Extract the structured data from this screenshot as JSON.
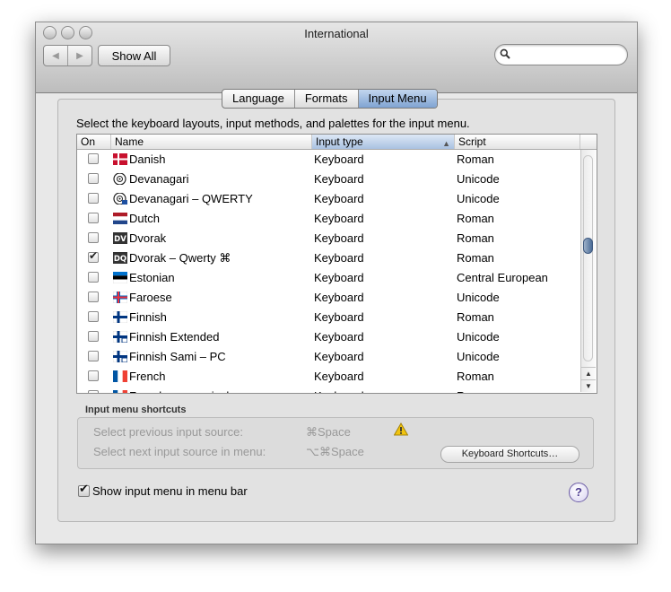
{
  "window": {
    "title": "International"
  },
  "toolbar": {
    "back_icon": "◀",
    "forward_icon": "▶",
    "show_all": "Show All",
    "search_placeholder": ""
  },
  "tabs": [
    {
      "label": "Language",
      "active": false
    },
    {
      "label": "Formats",
      "active": false
    },
    {
      "label": "Input Menu",
      "active": true
    }
  ],
  "instruction": "Select the keyboard layouts, input methods, and palettes for the input menu.",
  "table": {
    "columns": {
      "on": "On",
      "name": "Name",
      "input_type": "Input type",
      "script": "Script",
      "sort_arrow": "▲"
    },
    "rows": [
      {
        "checked": false,
        "flag": "danish-flag-icon",
        "name": "Danish",
        "type": "Keyboard",
        "script": "Roman"
      },
      {
        "checked": false,
        "flag": "devanagari-icon",
        "name": "Devanagari",
        "type": "Keyboard",
        "script": "Unicode"
      },
      {
        "checked": false,
        "flag": "devanagari-qwerty-icon",
        "name": "Devanagari – QWERTY",
        "type": "Keyboard",
        "script": "Unicode"
      },
      {
        "checked": false,
        "flag": "dutch-flag-icon",
        "name": "Dutch",
        "type": "Keyboard",
        "script": "Roman"
      },
      {
        "checked": false,
        "flag": "dvorak-icon",
        "badge": "DV",
        "name": "Dvorak",
        "type": "Keyboard",
        "script": "Roman"
      },
      {
        "checked": true,
        "flag": "dvorak-qwerty-icon",
        "badge": "DQ",
        "name": "Dvorak – Qwerty ⌘",
        "type": "Keyboard",
        "script": "Roman"
      },
      {
        "checked": false,
        "flag": "estonian-flag-icon",
        "name": "Estonian",
        "type": "Keyboard",
        "script": "Central European"
      },
      {
        "checked": false,
        "flag": "faroese-flag-icon",
        "name": "Faroese",
        "type": "Keyboard",
        "script": "Unicode"
      },
      {
        "checked": false,
        "flag": "finnish-flag-icon",
        "name": "Finnish",
        "type": "Keyboard",
        "script": "Roman"
      },
      {
        "checked": false,
        "flag": "finnish-extended-icon",
        "name": "Finnish Extended",
        "type": "Keyboard",
        "script": "Unicode"
      },
      {
        "checked": false,
        "flag": "finnish-sami-icon",
        "name": "Finnish Sami – PC",
        "type": "Keyboard",
        "script": "Unicode"
      },
      {
        "checked": false,
        "flag": "french-flag-icon",
        "name": "French",
        "type": "Keyboard",
        "script": "Roman"
      },
      {
        "checked": false,
        "flag": "french-flag-icon",
        "name": "French – numerical",
        "type": "Keyboard",
        "script": "Roman"
      }
    ],
    "scroll_up": "▲",
    "scroll_down": "▼"
  },
  "shortcuts": {
    "title": "Input menu shortcuts",
    "previous_label": "Select previous input source:",
    "previous_keys": "⌘Space",
    "next_label": "Select next input source in menu:",
    "next_keys": "⌥⌘Space",
    "button": "Keyboard Shortcuts…"
  },
  "show_menu": {
    "label": "Show input menu in menu bar",
    "checked": true
  },
  "help": {
    "label": "?"
  },
  "colors": {
    "tab_active": "#8fb0db",
    "scroll_thumb": "#5a7aa5",
    "warning": "#f1c40f",
    "help": "#6d5ea6"
  }
}
